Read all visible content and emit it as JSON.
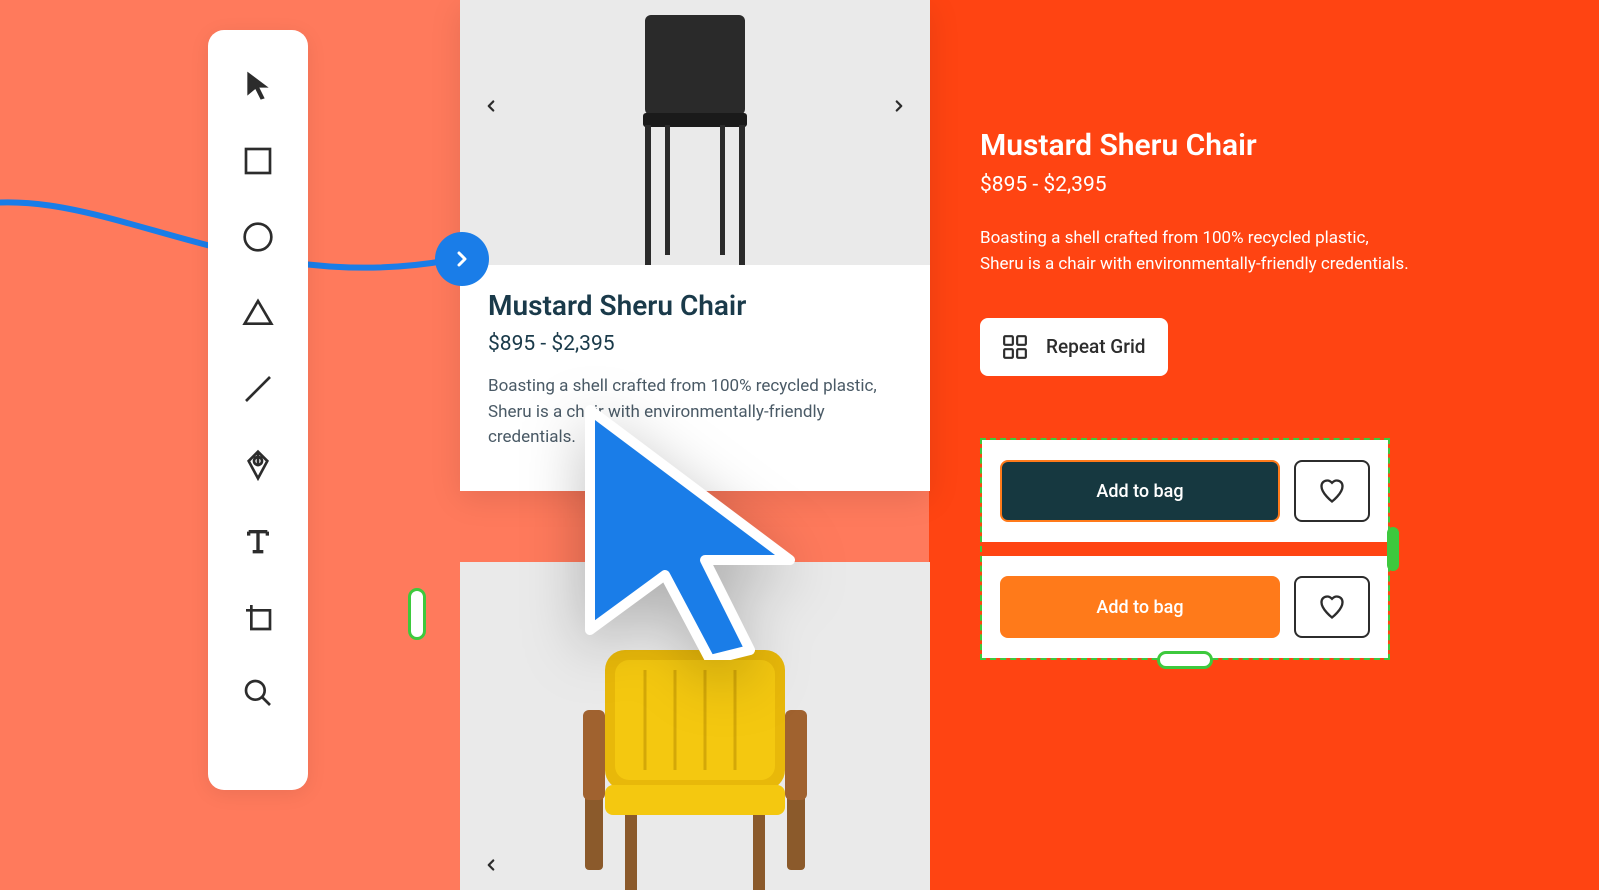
{
  "toolbar": {
    "tools": [
      "select",
      "rectangle",
      "ellipse",
      "triangle",
      "line",
      "pen",
      "text",
      "artboard",
      "zoom"
    ]
  },
  "product": {
    "title": "Mustard Sheru Chair",
    "price": "$895 - $2,395",
    "description": "Boasting a shell crafted from 100% recycled plastic, Sheru is a chair with environmentally-friendly credentials."
  },
  "rightPanel": {
    "title": "Mustard Sheru Chair",
    "price": "$895 - $2,395",
    "description": "Boasting a shell crafted from 100% recycled plastic, Sheru is a chair with environmentally-friendly credentials.",
    "repeatGridLabel": "Repeat Grid"
  },
  "buttons": {
    "addToBag1": "Add to bag",
    "addToBag2": "Add to bag"
  },
  "colors": {
    "bgLeft": "#ff7a5c",
    "bgRight": "#ff4412",
    "accent": "#1a7de8",
    "grid": "#3dc93d",
    "dark": "#163840",
    "orange": "#ff7a1a"
  }
}
